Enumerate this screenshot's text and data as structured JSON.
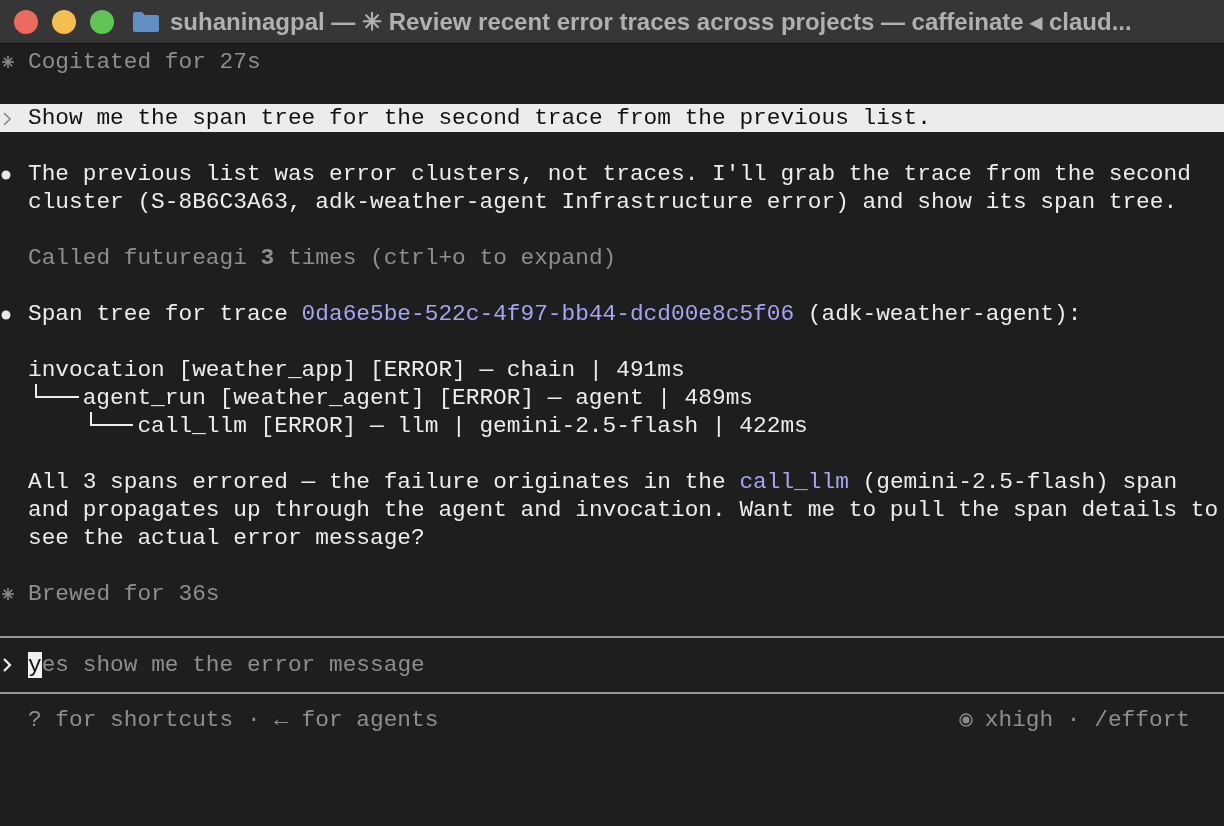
{
  "window": {
    "title": "suhaninagpal — ✳ Review recent error traces across projects — caffeinate ◂ claud..."
  },
  "transcript": [
    {
      "kind": "status",
      "text": "Cogitated for 27s"
    },
    {
      "kind": "user_prompt",
      "text": "Show me the span tree for the second trace from the previous list."
    },
    {
      "kind": "message",
      "segments": [
        {
          "kind": "plain",
          "text": "The previous list was error clusters, not traces. I'll grab the trace from the second cluster (S-8B6C3A63, adk-weather-agent Infrastructure error) and show its span tree."
        }
      ]
    },
    {
      "kind": "tool_call",
      "text": "Called futureagi **3** times (ctrl+o to expand)"
    },
    {
      "kind": "message",
      "segments": [
        {
          "kind": "plain",
          "text": "Span tree for trace "
        },
        {
          "kind": "link",
          "text": "0da6e5be-522c-4f97-bb44-dcd00e8c5f06"
        },
        {
          "kind": "plain",
          "text": " (adk-weather-agent):"
        }
      ]
    },
    {
      "kind": "tree",
      "nodes": [
        {
          "label": "invocation [weather_app] [ERROR] — chain | 491ms",
          "children": [
            {
              "label": "agent_run [weather_agent] [ERROR] — agent | 489ms",
              "children": [
                {
                  "label": "call_llm [ERROR] — llm | gemini-2.5-flash | 422ms"
                }
              ]
            }
          ]
        }
      ]
    },
    {
      "kind": "text",
      "segments": [
        {
          "kind": "plain",
          "text": "All 3 spans errored — the failure originates in the "
        },
        {
          "kind": "link",
          "text": "call_llm"
        },
        {
          "kind": "plain",
          "text": " (gemini-2.5-flash) span and propagates up through the agent and invocation. Want me to pull the span details to see the actual error message?"
        }
      ]
    },
    {
      "kind": "status",
      "text": "Brewed for 36s"
    }
  ],
  "input": {
    "value": "yes show me the error message"
  },
  "footer": {
    "hint": "? for shortcuts · ← for agents",
    "effort": "xhigh · /effort"
  }
}
